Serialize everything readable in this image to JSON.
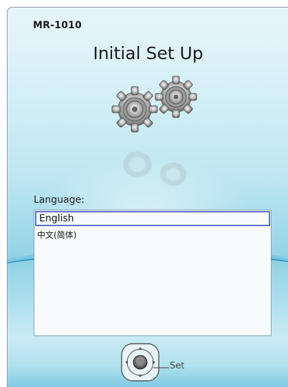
{
  "header": {
    "model": "MR-1010",
    "title": "Initial Set Up"
  },
  "language": {
    "label": "Language:",
    "options": [
      "English",
      "中文(简体)"
    ],
    "selected": "English"
  },
  "controls": {
    "set_label": "Set"
  },
  "colors": {
    "background_top": "#e6f5fa",
    "background_mid": "#9fd9ea",
    "wave_accent": "#1e8fc6",
    "selection_border": "#5a6fcf"
  },
  "icons": [
    "gears-icon",
    "dpad-icon"
  ]
}
